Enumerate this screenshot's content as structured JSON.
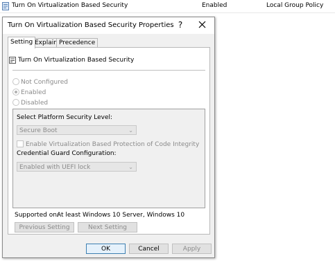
{
  "background_row": {
    "policy_name": "Turn On Virtualization Based Security",
    "state": "Enabled",
    "gpo": "Local Group Policy"
  },
  "dialog": {
    "title": "Turn On Virtualization Based Security Properties",
    "help_glyph": "?",
    "tabs": [
      {
        "label": "Setting",
        "active": true
      },
      {
        "label": "Explain",
        "active": false
      },
      {
        "label": "Precedence",
        "active": false
      }
    ],
    "policy_title": "Turn On Virtualization Based Security",
    "radio_options": [
      {
        "label": "Not Configured",
        "checked": false
      },
      {
        "label": "Enabled",
        "checked": true
      },
      {
        "label": "Disabled",
        "checked": false
      }
    ],
    "options": {
      "platform_label": "Select Platform Security Level:",
      "platform_value": "Secure Boot",
      "code_integrity_label": "Enable Virtualization Based Protection of Code Integrity",
      "code_integrity_checked": false,
      "credential_guard_label": "Credential Guard Configuration:",
      "credential_guard_value": "Enabled with UEFI lock"
    },
    "supported_on_label": "Supported on:",
    "supported_on_value": "At least Windows 10 Server, Windows 10",
    "buttons": {
      "previous": "Previous Setting",
      "next": "Next Setting",
      "ok": "OK",
      "cancel": "Cancel",
      "apply": "Apply"
    }
  }
}
